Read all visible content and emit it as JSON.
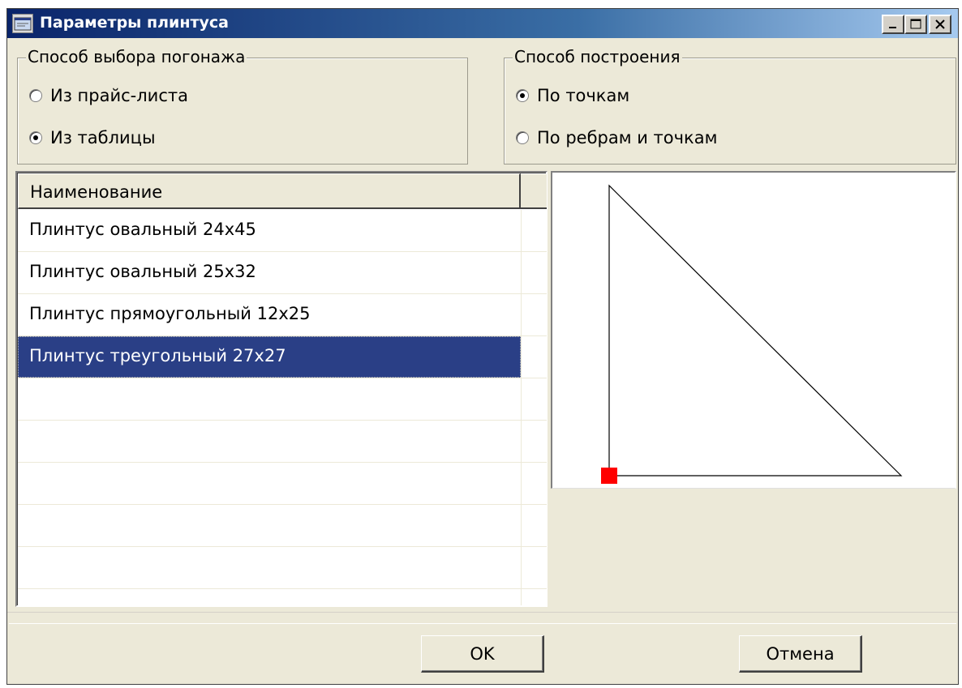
{
  "window": {
    "title": "Параметры плинтуса",
    "app_icon": "app-window-icon",
    "controls": [
      "minimize-icon",
      "maximize-icon",
      "close-icon"
    ]
  },
  "selection_method": {
    "title": "Способ выбора  погонажа",
    "options": [
      {
        "label": "Из прайс-листа",
        "checked": false
      },
      {
        "label": "Из таблицы",
        "checked": true
      }
    ]
  },
  "build_method": {
    "title": "Способ построения",
    "options": [
      {
        "label": "По точкам",
        "checked": true
      },
      {
        "label": "По ребрам и точкам",
        "checked": false
      }
    ]
  },
  "table": {
    "header": "Наименование",
    "rows": [
      "Плинтус овальный 24x45",
      "Плинтус овальный 25x32",
      "Плинтус прямоугольный 12x25",
      "Плинтус треугольный 27x27"
    ],
    "selected_index": 3
  },
  "preview": {
    "shape": "triangle",
    "line_color": "#000000",
    "marker_color": "#ff0000"
  },
  "buttons": {
    "ok": "OK",
    "cancel": "Отмена"
  }
}
